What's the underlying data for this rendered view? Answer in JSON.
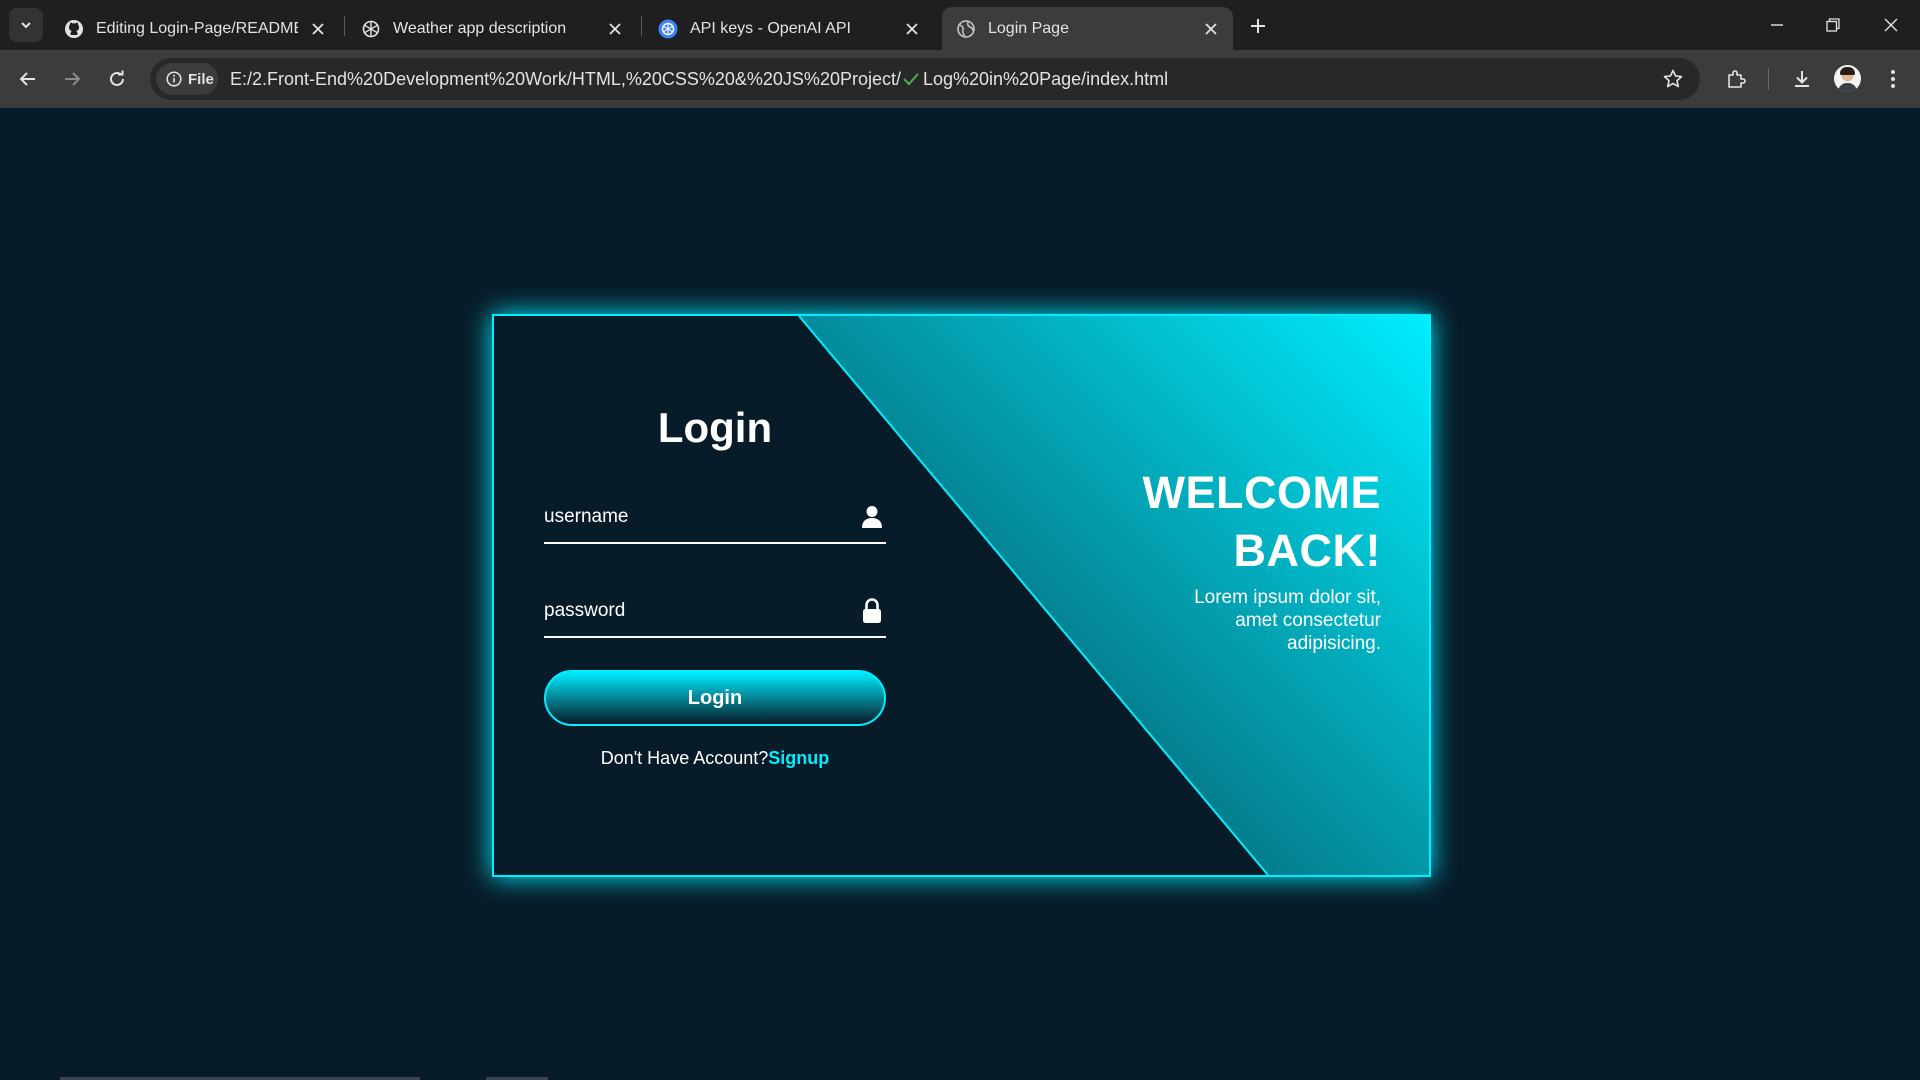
{
  "browser": {
    "tabs": [
      {
        "title": "Editing Login-Page/README.m",
        "icon": "github-icon",
        "active": false
      },
      {
        "title": "Weather app description",
        "icon": "openai-icon",
        "active": false
      },
      {
        "title": "API keys - OpenAI API",
        "icon": "openai-api-icon",
        "active": false
      },
      {
        "title": "Login Page",
        "icon": "globe-icon",
        "active": true
      }
    ],
    "chip_label": "File",
    "url_part1": "E:/2.Front-End%20Development%20Work/HTML,%20CSS%20&%20JS%20Project/",
    "url_part2": "Log%20in%20Page/index.html"
  },
  "login": {
    "title": "Login",
    "username_placeholder": "username",
    "password_placeholder": "password",
    "button_label": "Login",
    "account_prompt": "Don't Have Account?",
    "signup_link": "Signup"
  },
  "welcome": {
    "line1": "WELCOME",
    "line2": "BACK!",
    "text_line1": "Lorem ipsum dolor sit,",
    "text_line2": "amet consectetur",
    "text_line3": "adipisicing."
  },
  "colors": {
    "background": "#081b29",
    "accent": "#00eeff",
    "chrome_dark": "#1f1f1f",
    "chrome_toolbar": "#3c3c3c"
  }
}
